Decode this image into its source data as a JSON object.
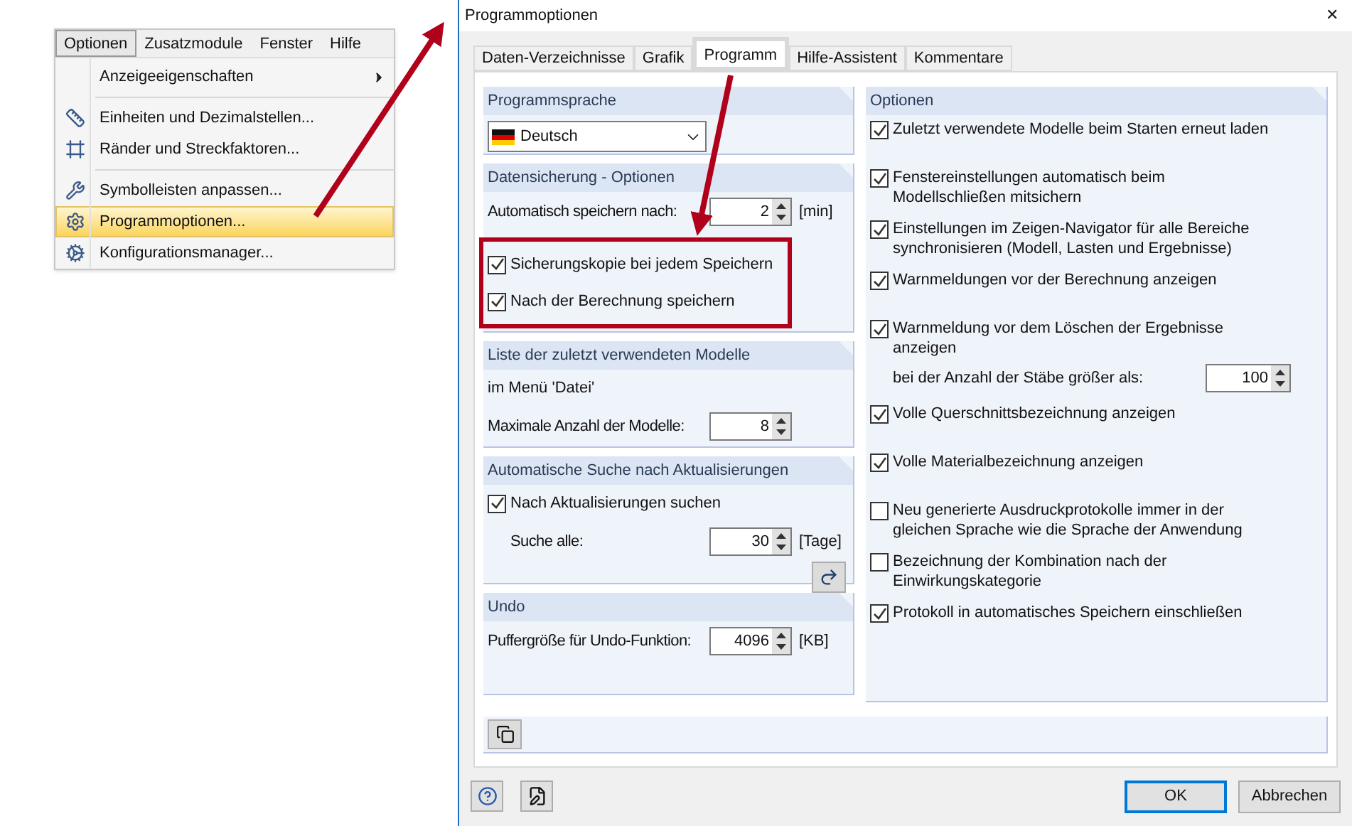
{
  "menu": {
    "bar": [
      {
        "label": "Optionen",
        "selected": true
      },
      {
        "label": "Zusatzmodule",
        "selected": false
      },
      {
        "label": "Fenster",
        "selected": false
      },
      {
        "label": "Hilfe",
        "selected": false
      }
    ],
    "groups": [
      [
        {
          "label": "Anzeigeeigenschaften",
          "submenu": true,
          "highlighted": false
        }
      ],
      [
        {
          "label": "Einheiten und Dezimalstellen...",
          "submenu": false,
          "highlighted": false
        },
        {
          "label": "Ränder und Streckfaktoren...",
          "submenu": false,
          "highlighted": false
        }
      ],
      [
        {
          "label": "Symbolleisten anpassen...",
          "submenu": false,
          "highlighted": false
        },
        {
          "label": "Programmoptionen...",
          "submenu": false,
          "highlighted": true
        },
        {
          "label": "Konfigurationsmanager...",
          "submenu": false,
          "highlighted": false
        }
      ]
    ]
  },
  "dialog": {
    "title": "Programmoptionen",
    "close": "✕",
    "tabs": [
      {
        "label": "Daten-Verzeichnisse",
        "selected": false
      },
      {
        "label": "Grafik",
        "selected": false
      },
      {
        "label": "Programm",
        "selected": true
      },
      {
        "label": "Hilfe-Assistent",
        "selected": false
      },
      {
        "label": "Kommentare",
        "selected": false
      }
    ],
    "left_sections": [
      {
        "title": "Programmsprache",
        "rows": [
          {
            "kind": "dropdown",
            "value": "Deutsch"
          }
        ]
      },
      {
        "title": "Datensicherung - Optionen",
        "rows": [
          {
            "kind": "spin",
            "label": "Automatisch speichern nach:",
            "value": "2",
            "unit": "[min]"
          },
          {
            "kind": "callout",
            "rows": [
              {
                "kind": "checkbox",
                "label": "Sicherungskopie bei jedem Speichern",
                "checked": true
              },
              {
                "kind": "checkbox",
                "label": "Nach der Berechnung speichern",
                "checked": true
              }
            ]
          }
        ]
      },
      {
        "title": "Liste der zuletzt verwendeten Modelle",
        "rows": [
          {
            "kind": "text",
            "label": "im Menü 'Datei'"
          },
          {
            "kind": "spin",
            "label": "Maximale Anzahl der Modelle:",
            "value": "8"
          }
        ]
      },
      {
        "title": "Automatische Suche nach Aktualisierungen",
        "rows": [
          {
            "kind": "checkbox",
            "label": "Nach Aktualisierungen suchen",
            "checked": true
          },
          {
            "kind": "spin",
            "label": "Suche alle:",
            "value": "30",
            "unit": "[Tage]",
            "indent": true
          },
          {
            "kind": "icon_button"
          }
        ]
      },
      {
        "title": "Undo",
        "rows": [
          {
            "kind": "spin",
            "label": "Puffergröße für Undo-Funktion:",
            "value": "4096",
            "unit": "[KB]"
          }
        ]
      }
    ],
    "options": {
      "title": "Optionen",
      "items": [
        {
          "label": "Zuletzt verwendete Modelle beim Starten erneut laden",
          "checked": true
        },
        {
          "label": "Fenstereinstellungen automatisch beim Modellschließen mitsichern",
          "checked": true
        },
        {
          "label": "Einstellungen im Zeigen-Navigator für alle Bereiche synchronisieren (Modell, Lasten und Ergebnisse)",
          "checked": true
        },
        {
          "label": "Warnmeldungen vor der Berechnung anzeigen",
          "checked": true
        },
        {
          "label": "Warnmeldung vor dem Löschen der Ergebnisse anzeigen",
          "checked": true,
          "spin": {
            "label": "bei der Anzahl der Stäbe größer als:",
            "value": "100"
          }
        },
        {
          "label": "Volle Querschnittsbezeichnung anzeigen",
          "checked": true
        },
        {
          "label": "Volle Materialbezeichnung anzeigen",
          "checked": true
        },
        {
          "label": "Neu generierte Ausdruckprotokolle immer in der gleichen Sprache wie die Sprache der Anwendung",
          "checked": false
        },
        {
          "label": "Bezeichnung der Kombination nach der Einwirkungskategorie",
          "checked": false
        },
        {
          "label": "Protokoll in automatisches Speichern einschließen",
          "checked": true
        }
      ]
    },
    "buttons": [
      {
        "label": "OK",
        "default": true
      },
      {
        "label": "Abbrechen",
        "default": false
      }
    ]
  }
}
